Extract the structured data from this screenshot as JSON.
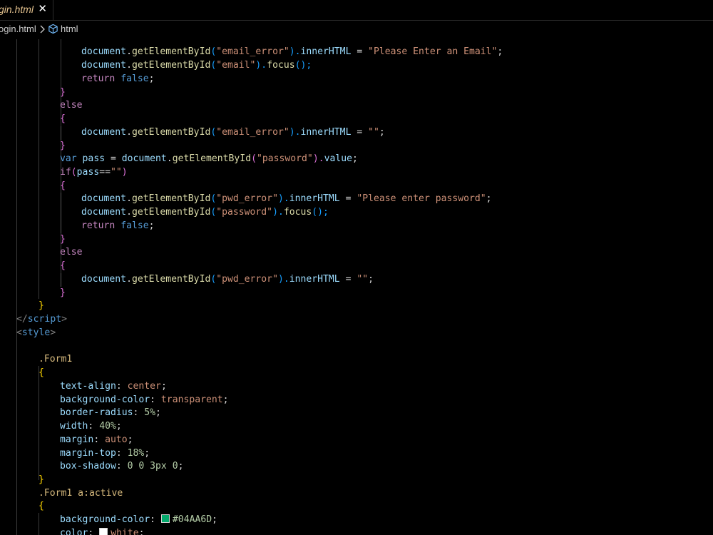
{
  "tab": {
    "label": "gin.html",
    "close_glyph": "✕"
  },
  "breadcrumb": {
    "file": "ogin.html",
    "symbol": "html"
  },
  "colors": {
    "swatch_green": "#04AA6D",
    "swatch_white": "#ffffff"
  },
  "code": {
    "l1": {
      "a": "document",
      "b": ".",
      "c": "getElementById",
      "d": "(",
      "e": "\"email_error\"",
      "f": ").",
      "g": "innerHTML",
      "h": " = ",
      "i": "\"Please Enter an Email\"",
      "j": ";"
    },
    "l2": {
      "a": "document",
      "b": ".",
      "c": "getElementById",
      "d": "(",
      "e": "\"email\"",
      "f": ").",
      "g": "focus",
      "h": "();"
    },
    "l3": {
      "a": "return",
      "b": " ",
      "c": "false",
      "d": ";"
    },
    "l4": {
      "a": "}"
    },
    "l5": {
      "a": "else"
    },
    "l6": {
      "a": "{"
    },
    "l7": {
      "a": "document",
      "b": ".",
      "c": "getElementById",
      "d": "(",
      "e": "\"email_error\"",
      "f": ").",
      "g": "innerHTML",
      "h": " = ",
      "i": "\"\"",
      "j": ";"
    },
    "l8": {
      "a": "}"
    },
    "l9": {
      "a": "var",
      "b": " ",
      "c": "pass",
      "d": " = ",
      "e": "document",
      "f": ".",
      "g": "getElementById",
      "h": "(",
      "i": "\"password\"",
      "j": ").",
      "k": "value",
      "l": ";"
    },
    "l10": {
      "a": "if",
      "b": "(",
      "c": "pass",
      "d": "==",
      "e": "\"\"",
      "f": ")"
    },
    "l11": {
      "a": "{"
    },
    "l12": {
      "a": "document",
      "b": ".",
      "c": "getElementById",
      "d": "(",
      "e": "\"pwd_error\"",
      "f": ").",
      "g": "innerHTML",
      "h": " = ",
      "i": "\"Please enter password\"",
      "j": ";"
    },
    "l13": {
      "a": "document",
      "b": ".",
      "c": "getElementById",
      "d": "(",
      "e": "\"password\"",
      "f": ").",
      "g": "focus",
      "h": "();"
    },
    "l14": {
      "a": "return",
      "b": " ",
      "c": "false",
      "d": ";"
    },
    "l15": {
      "a": "}"
    },
    "l16": {
      "a": "else"
    },
    "l17": {
      "a": "{"
    },
    "l18": {
      "a": "document",
      "b": ".",
      "c": "getElementById",
      "d": "(",
      "e": "\"pwd_error\"",
      "f": ").",
      "g": "innerHTML",
      "h": " = ",
      "i": "\"\"",
      "j": ";"
    },
    "l19": {
      "a": "}"
    },
    "l20": {
      "a": "}"
    },
    "l21": {
      "a": "</",
      "b": "script",
      "c": ">"
    },
    "l22": {
      "a": "<",
      "b": "style",
      "c": ">"
    },
    "l24": {
      "a": ".Form1"
    },
    "l25": {
      "a": "{"
    },
    "l26": {
      "a": "text-align",
      "b": ": ",
      "c": "center",
      "d": ";"
    },
    "l27": {
      "a": "background-color",
      "b": ": ",
      "c": "transparent",
      "d": ";"
    },
    "l28": {
      "a": "border-radius",
      "b": ": ",
      "c": "5%",
      "d": ";"
    },
    "l29": {
      "a": "width",
      "b": ": ",
      "c": "40%",
      "d": ";"
    },
    "l30": {
      "a": "margin",
      "b": ": ",
      "c": "auto",
      "d": ";"
    },
    "l31": {
      "a": "margin-top",
      "b": ": ",
      "c": "18%",
      "d": ";"
    },
    "l32": {
      "a": "box-shadow",
      "b": ": ",
      "c": "0 0 3px 0",
      "d": ";"
    },
    "l33": {
      "a": "}"
    },
    "l34": {
      "a": ".Form1 a:active"
    },
    "l35": {
      "a": "{"
    },
    "l36": {
      "a": "background-color",
      "b": ": ",
      "c": "#04AA6D",
      "d": ";"
    },
    "l37": {
      "a": "color",
      "b": ": ",
      "c": "white",
      "d": ";"
    }
  }
}
